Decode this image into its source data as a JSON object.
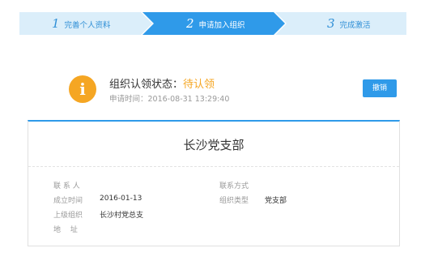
{
  "stepper": {
    "steps": [
      {
        "num": "1",
        "label": "完善个人资料"
      },
      {
        "num": "2",
        "label": "申请加入组织"
      },
      {
        "num": "3",
        "label": "完成激活"
      }
    ],
    "active_step": 2,
    "colors": {
      "active": "#2f9ae9",
      "inactive": "#dbeefa"
    }
  },
  "status": {
    "icon": "info-icon",
    "label": "组织认领状态：",
    "value": "待认领",
    "time": "申请时间：2016-08-31 13:29:40",
    "cancel_label": "撤销"
  },
  "card": {
    "title": "长沙党支部",
    "fields": {
      "contact": {
        "label": "联 系 人",
        "value": ""
      },
      "contact_method": {
        "label": "联系方式",
        "value": ""
      },
      "founded": {
        "label": "成立时间",
        "value": "2016-01-13"
      },
      "org_type": {
        "label": "组织类型",
        "value": "党支部"
      },
      "parent_org": {
        "label": "上级组织",
        "value": "长沙村党总支"
      },
      "address": {
        "label": "地　 址",
        "value": ""
      }
    }
  },
  "colors": {
    "accent": "#2f9ae9",
    "warning": "#f5a623",
    "muted": "#999999"
  }
}
